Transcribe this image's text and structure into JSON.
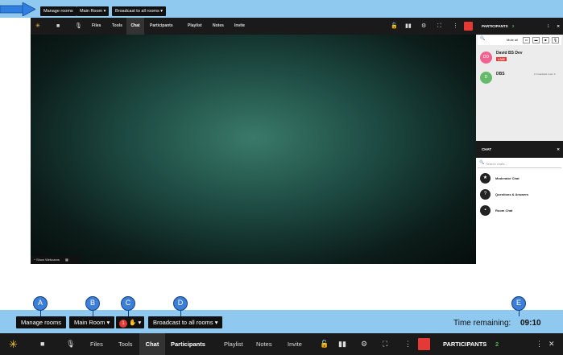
{
  "top_toolbar": {
    "manage_rooms": "Manage rooms",
    "main_room": "Main Room",
    "broadcast": "Broadcast to all rooms"
  },
  "nav": {
    "files": "Files",
    "tools": "Tools",
    "chat": "Chat",
    "participants": "Participants",
    "playlist": "Playlist",
    "notes": "Notes",
    "invite": "Invite"
  },
  "participants_panel": {
    "title": "PARTICIPANTS",
    "count": "2",
    "mute_all": "Mute all",
    "users": [
      {
        "initials": "DD",
        "name": "David BS Dev",
        "badge": "LIVE",
        "color": "#f06292"
      },
      {
        "initials": "D",
        "name": "DBS",
        "status": "in broadcast room 2",
        "color": "#66bb6a"
      }
    ]
  },
  "chat_panel": {
    "title": "CHAT",
    "search_placeholder": "Search chats...",
    "chats": [
      {
        "name": "Moderator Chat",
        "icon": "star-icon"
      },
      {
        "name": "Questions & Answers",
        "icon": "question-icon"
      },
      {
        "name": "Room Chat",
        "icon": "chat-bubble-icon"
      }
    ]
  },
  "show_webcams": "^ Show Webcams",
  "bottom_toolbar": {
    "manage_rooms": "Manage rooms",
    "main_room": "Main Room",
    "hand_count": "1",
    "broadcast": "Broadcast to all rooms",
    "time_label": "Time remaining:",
    "time_value": "09:10"
  },
  "bottom_nav": {
    "files": "Files",
    "tools": "Tools",
    "chat": "Chat",
    "participants": "Participants",
    "playlist": "Playlist",
    "notes": "Notes",
    "invite": "Invite",
    "participants_title": "PARTICIPANTS",
    "participants_count": "2"
  },
  "callouts": [
    "A",
    "B",
    "C",
    "D",
    "E"
  ],
  "colors": {
    "accent_blue": "#8fc9ef",
    "leave_red": "#e53935",
    "live_red": "#e53935",
    "count_green": "#4caf50"
  }
}
